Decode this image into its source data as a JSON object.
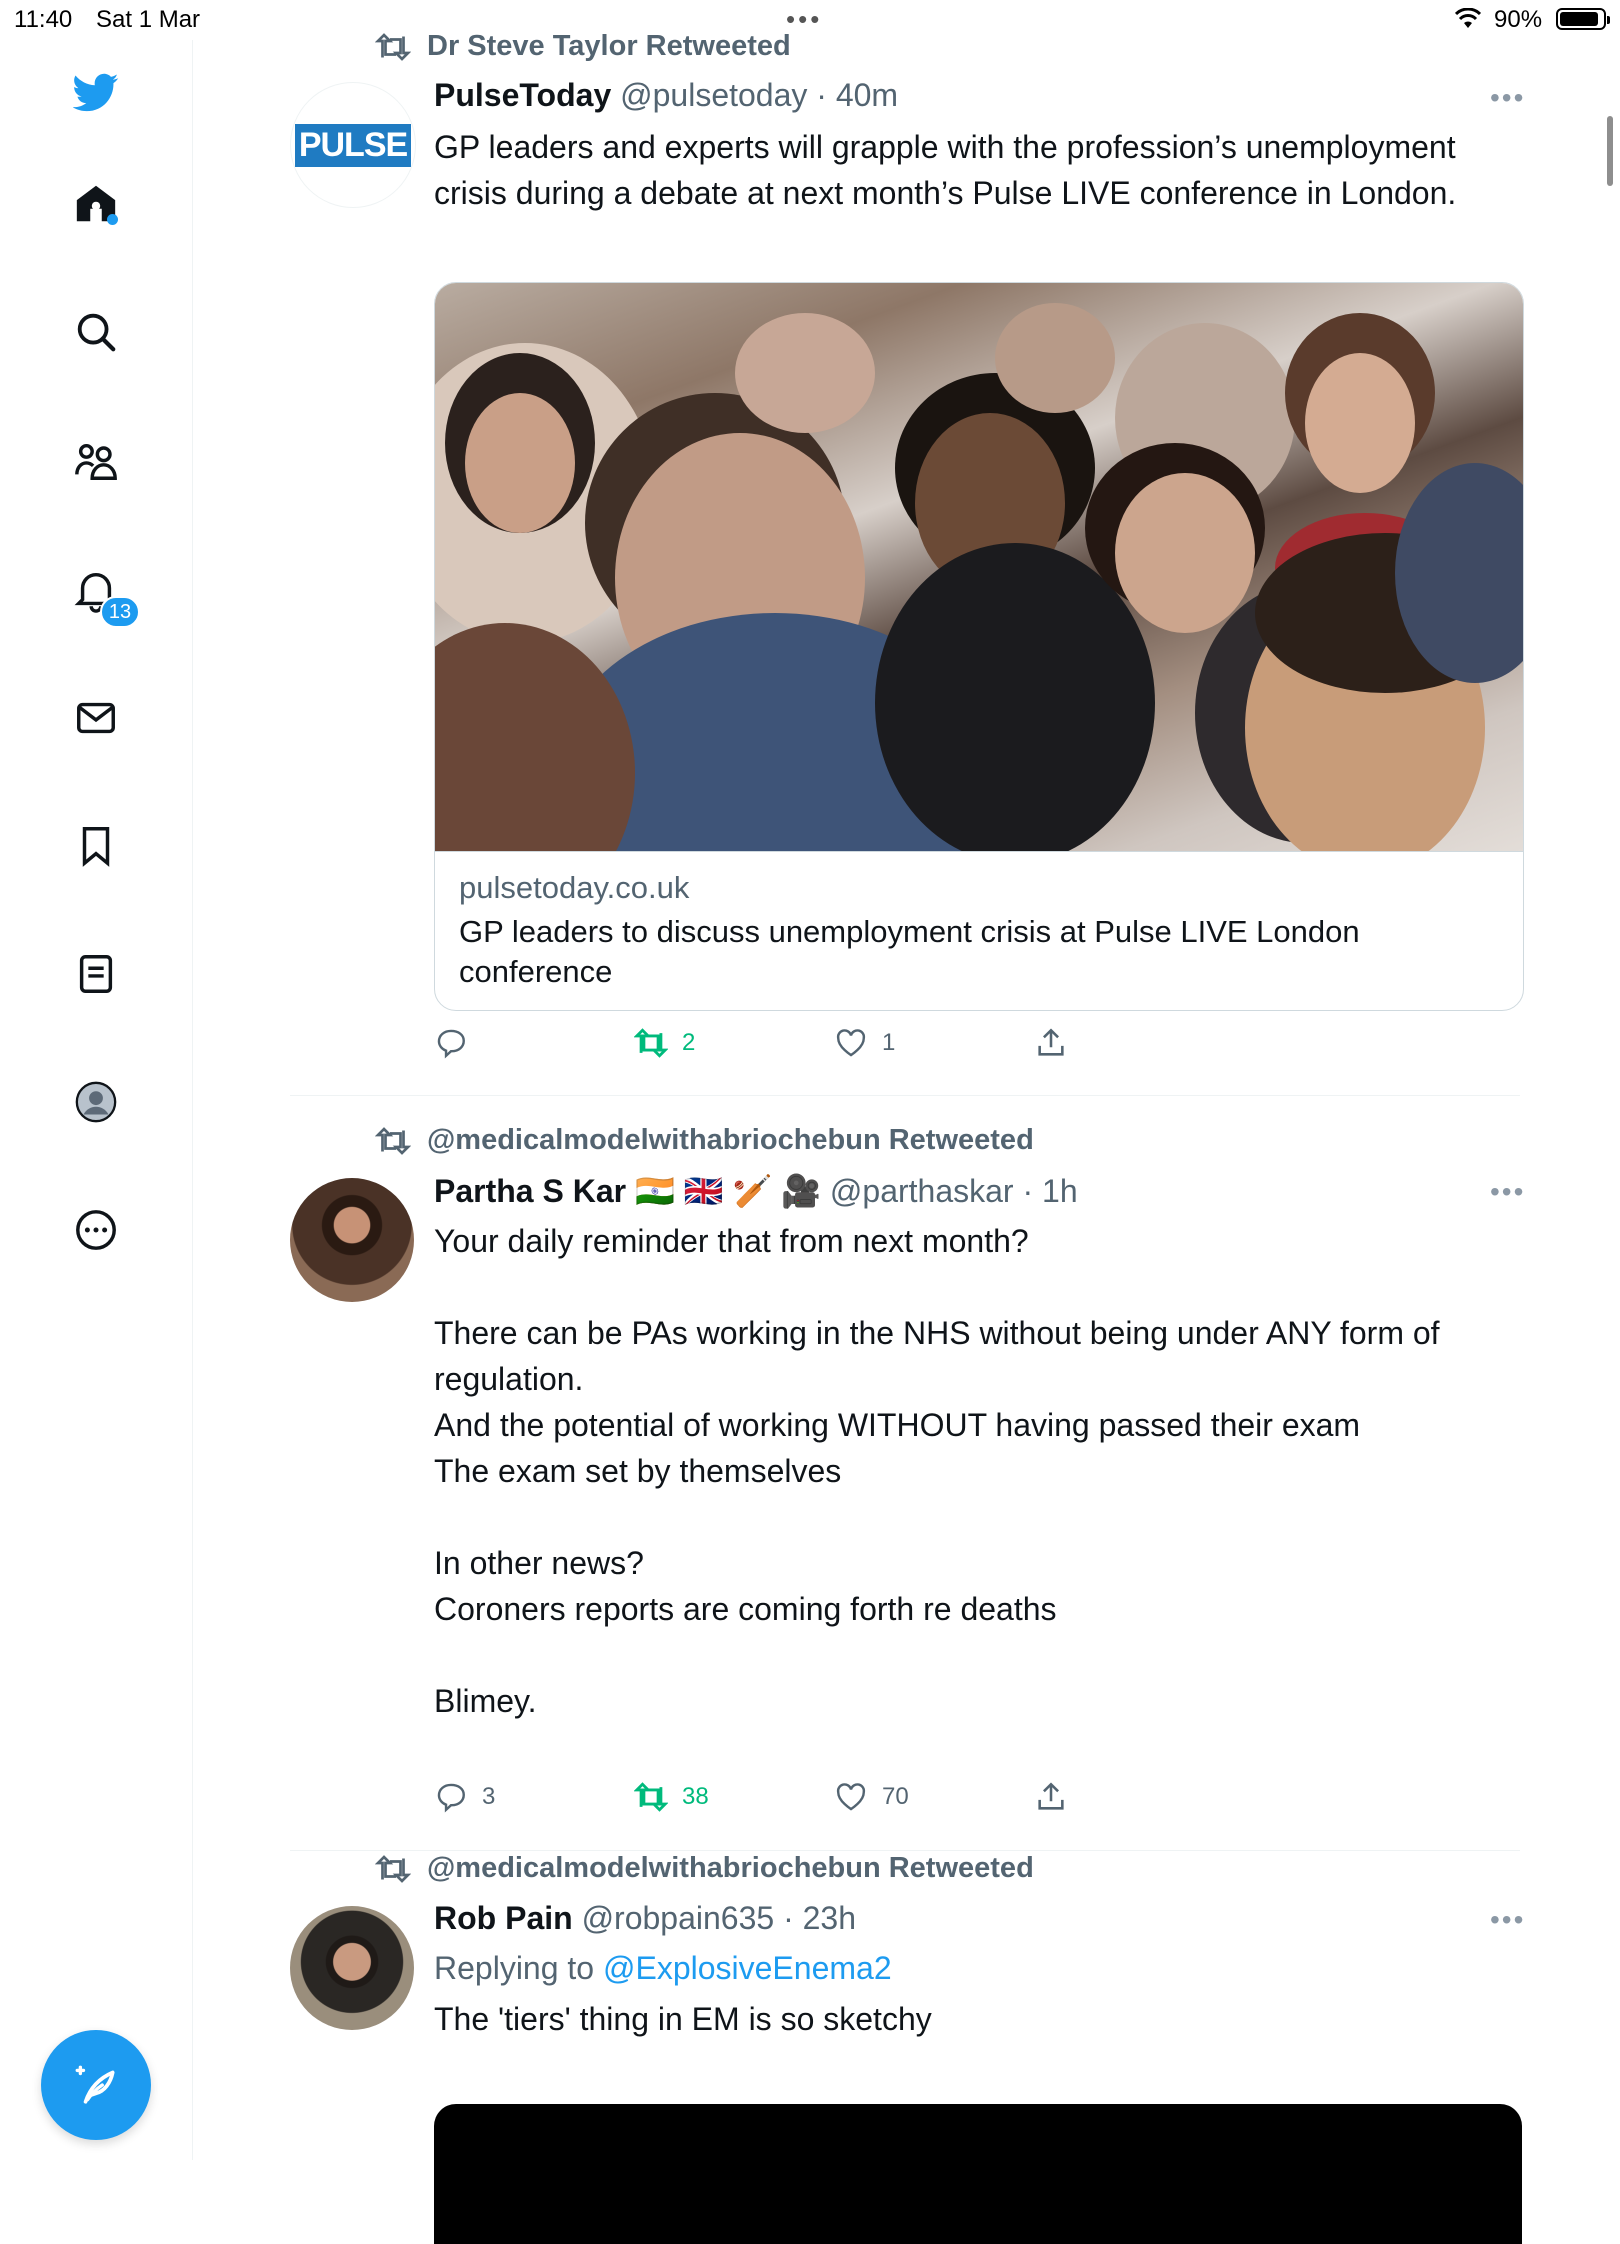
{
  "status_bar": {
    "time": "11:40",
    "date": "Sat 1 Mar",
    "battery": "90%",
    "battery_level": 0.9
  },
  "sidebar": {
    "items": [
      {
        "name": "home-icon"
      },
      {
        "name": "search-icon"
      },
      {
        "name": "communities-icon"
      },
      {
        "name": "notifications-icon"
      },
      {
        "name": "messages-icon"
      },
      {
        "name": "bookmarks-icon"
      },
      {
        "name": "lists-icon"
      },
      {
        "name": "profile-icon"
      },
      {
        "name": "more-icon"
      }
    ],
    "notifications_badge": "13"
  },
  "tweets": [
    {
      "retweeted_by": "Dr Steve Taylor Retweeted",
      "name": "PulseToday",
      "handle": "@pulsetoday",
      "time": "40m",
      "avatar_text": "PULSE",
      "text": "GP leaders and experts will grapple with the profession’s unemployment crisis during a debate at next month’s Pulse LIVE conference in London.",
      "card": {
        "domain": "pulsetoday.co.uk",
        "title": "GP leaders to discuss unemployment crisis at Pulse LIVE London conference"
      },
      "replies": "",
      "retweets": "2",
      "likes": "1"
    },
    {
      "retweeted_by": "@medicalmodelwithabriochebun Retweeted",
      "name": "Partha S Kar",
      "name_emoji": "🇮🇳 🇬🇧 🏏 🎥",
      "handle": "@parthaskar",
      "time": "1h",
      "text": "Your daily reminder that from next month?\n\nThere can be PAs working in the NHS without being under ANY form of regulation.\nAnd the potential of working WITHOUT having passed their exam\nThe exam set by themselves\n\nIn other news?\nCoroners reports are coming forth re deaths\n\nBlimey.",
      "replies": "3",
      "retweets": "38",
      "likes": "70"
    },
    {
      "retweeted_by": "@medicalmodelwithabriochebun Retweeted",
      "name": "Rob Pain",
      "handle": "@robpain635",
      "time": "23h",
      "replying_label": "Replying to",
      "replying_to": "@ExplosiveEnema2",
      "text": "The 'tiers' thing in EM is so sketchy"
    }
  ],
  "separator": "·"
}
